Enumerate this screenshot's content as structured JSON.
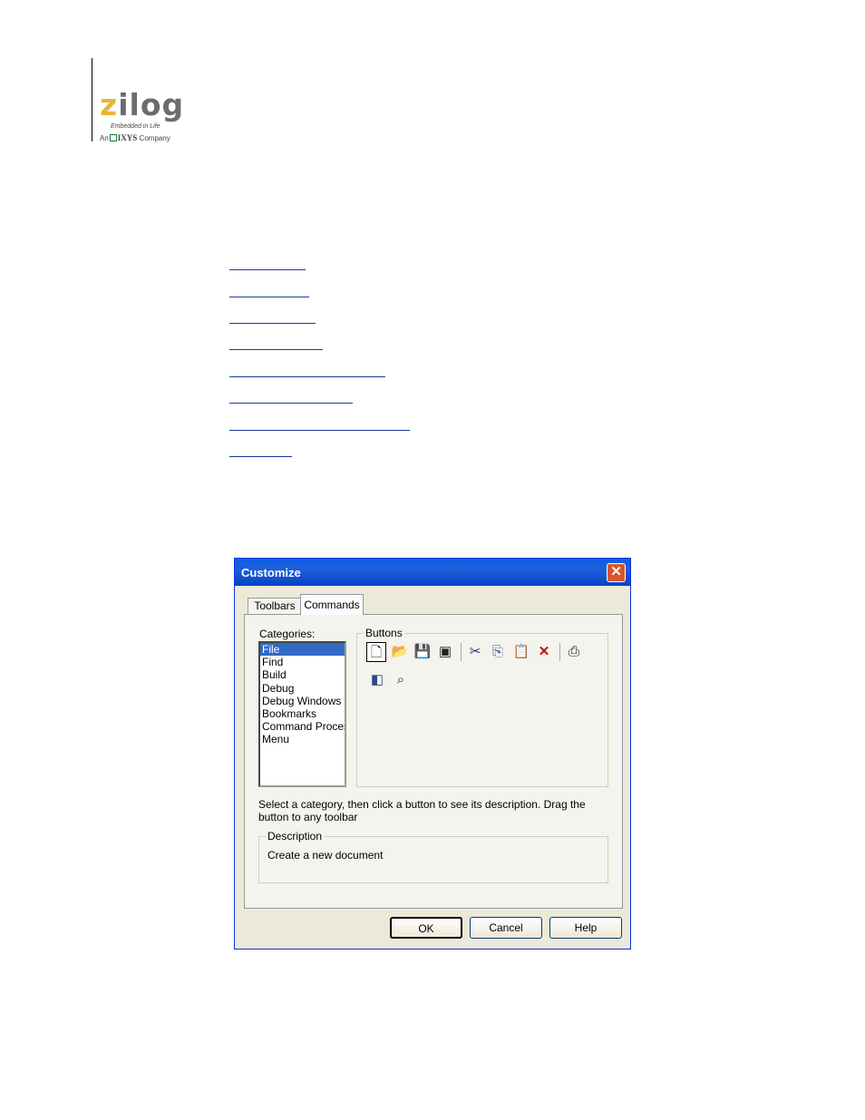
{
  "logo": {
    "name": "zilog",
    "tagline": "Embedded in Life",
    "company_prefix": "An",
    "company_name": "IXYS",
    "company_suffix": "Company"
  },
  "dialog": {
    "title": "Customize",
    "tabs": [
      "Toolbars",
      "Commands"
    ],
    "categories_label": "Categories:",
    "categories": [
      "File",
      "Find",
      "Build",
      "Debug",
      "Debug Windows",
      "Bookmarks",
      "Command Proces",
      "Menu"
    ],
    "selected_category": "File",
    "buttons_label": "Buttons",
    "buttons": [
      "new-document",
      "open",
      "save",
      "save-all",
      "cut",
      "copy",
      "paste",
      "delete",
      "print",
      "workspace",
      "find-in-files"
    ],
    "hint": "Select a category, then click a button to see its description. Drag the button to any toolbar",
    "description_label": "Description",
    "description": "Create a new document",
    "ok": "OK",
    "cancel": "Cancel",
    "help": "Help",
    "close_icon": "close-icon"
  }
}
